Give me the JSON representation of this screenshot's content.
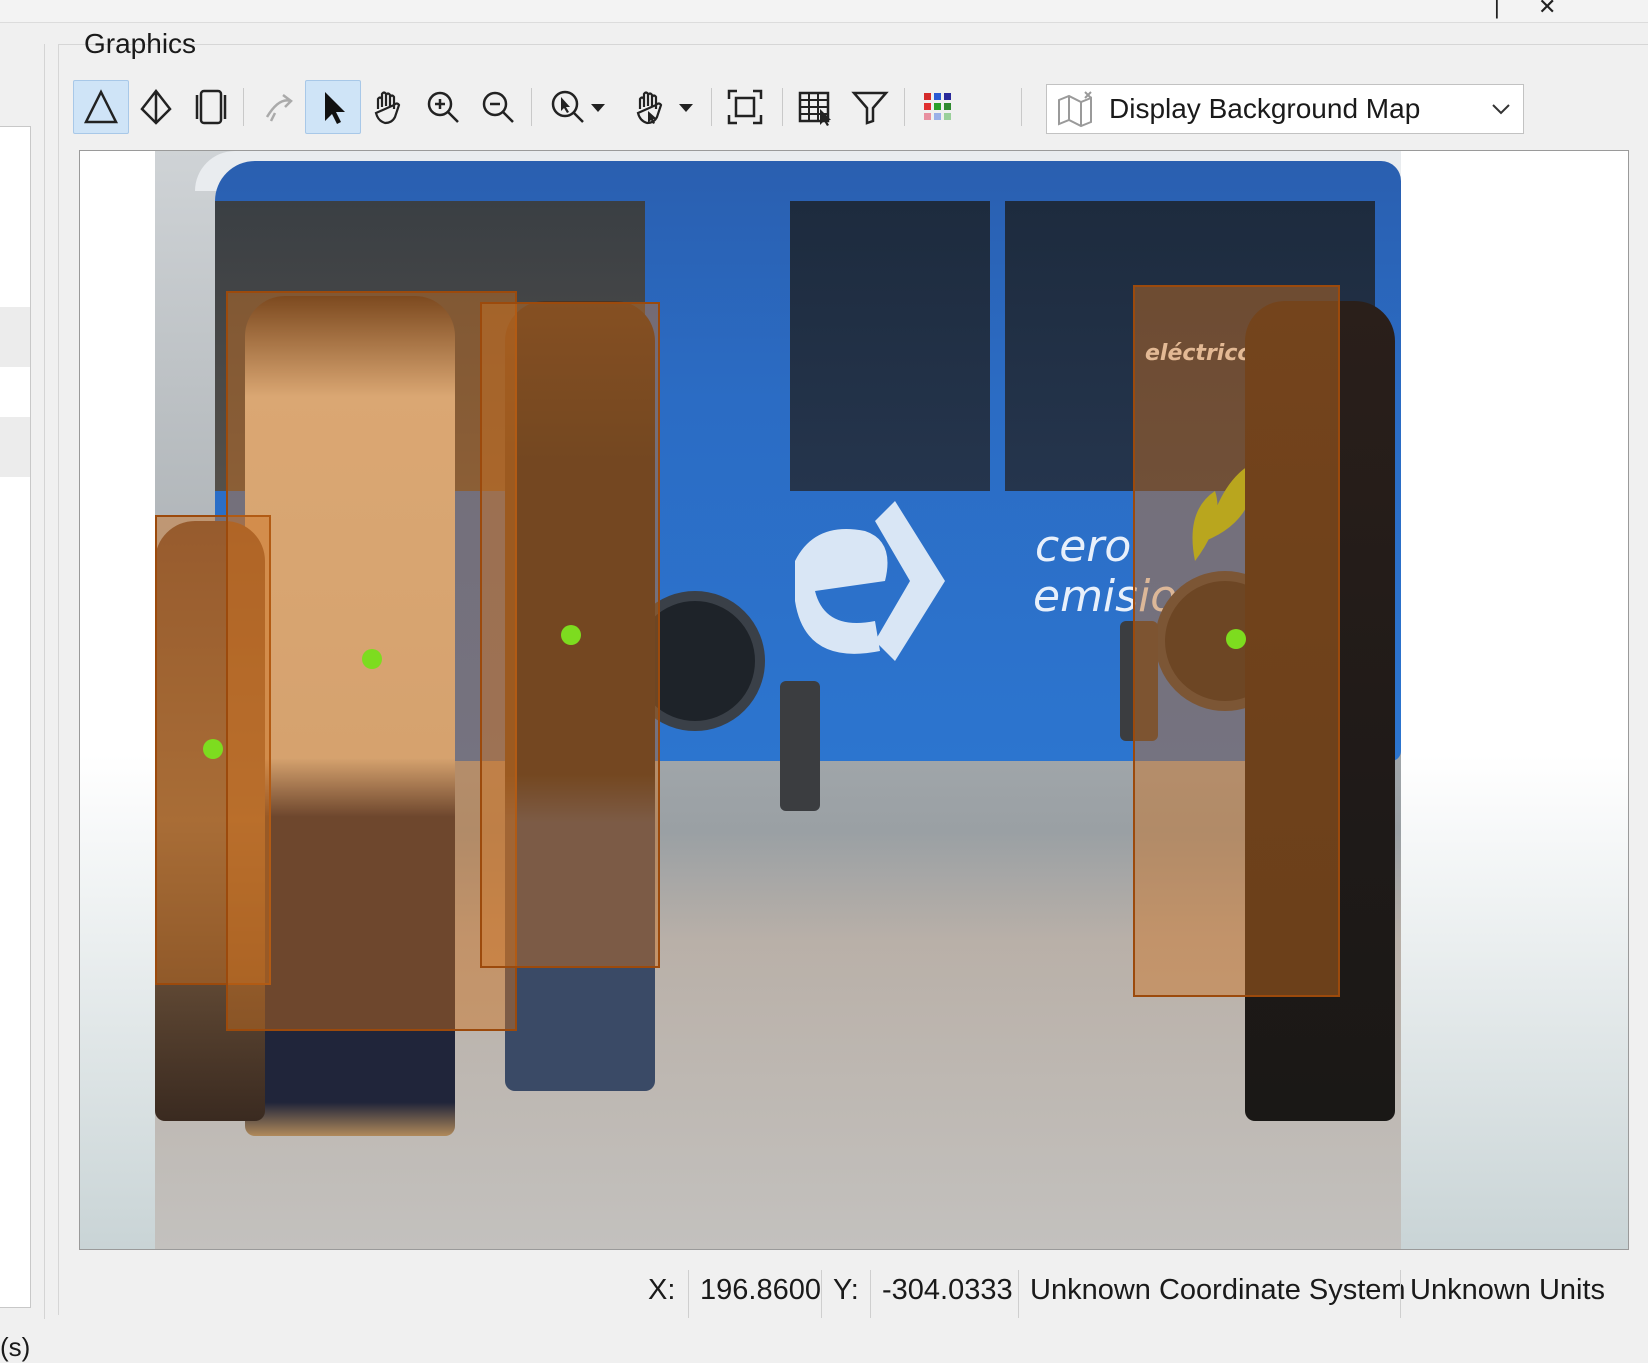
{
  "window": {
    "controls": {
      "minimize": "‾",
      "maximize": "|",
      "close": "✕"
    }
  },
  "left_panel": {
    "truncated_dot": ".",
    "truncated_label": "(s)"
  },
  "pane": {
    "title": "Graphics"
  },
  "toolbar": {
    "tools": [
      {
        "name": "triangle-tool-icon",
        "active": true
      },
      {
        "name": "prism-tool-icon",
        "active": false
      },
      {
        "name": "cylinder-tool-icon",
        "active": false
      },
      {
        "name": "lasso-select-icon",
        "active": false
      },
      {
        "name": "select-arrow-icon",
        "active": true
      },
      {
        "name": "pan-hand-icon",
        "active": false
      },
      {
        "name": "zoom-in-icon",
        "active": false
      },
      {
        "name": "zoom-out-icon",
        "active": false
      },
      {
        "name": "zoom-to-point-icon",
        "active": false
      },
      {
        "name": "pan-mode-icon",
        "active": false
      },
      {
        "name": "zoom-extent-icon",
        "active": false
      },
      {
        "name": "attribute-table-icon",
        "active": false
      },
      {
        "name": "filter-icon",
        "active": false
      },
      {
        "name": "color-grid-icon",
        "active": false
      }
    ],
    "background_map": {
      "label": "Display Background Map"
    }
  },
  "canvas": {
    "image_subject": "street-scene-with-blue-bus",
    "bus_text": {
      "line1": "cero",
      "line2": "emisiones",
      "brand": "eléctricoEMT"
    },
    "detection_color": "#ce701e",
    "keypoint_color": "#7ddc1f"
  },
  "status": {
    "x_label": "X:",
    "x_value": "196.8600",
    "y_label": "Y:",
    "y_value": "-304.0333",
    "coordinate_system": "Unknown Coordinate System",
    "units": "Unknown Units"
  }
}
